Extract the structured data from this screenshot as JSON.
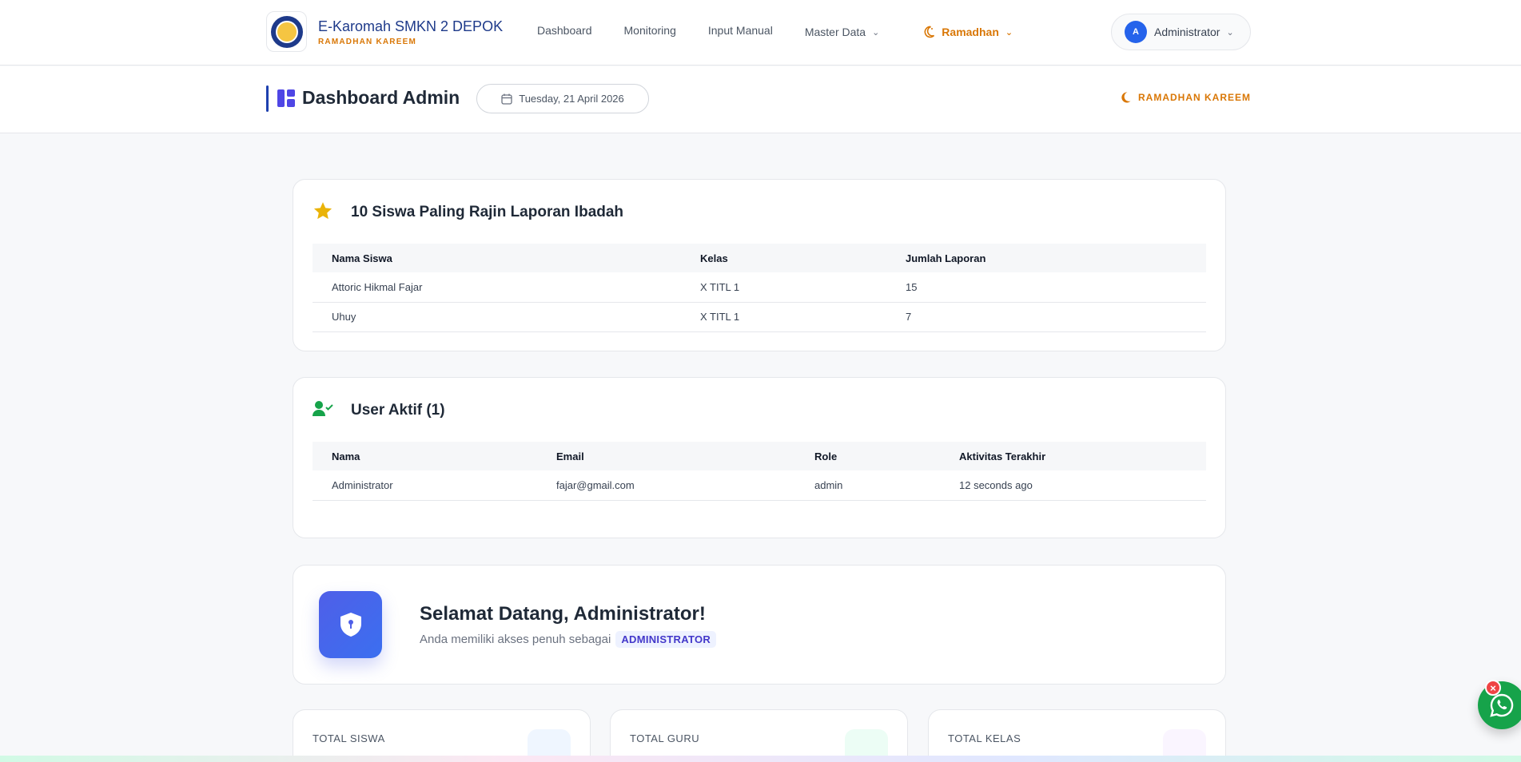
{
  "brand": {
    "title": "E-Karomah SMKN 2 DEPOK",
    "subtitle": "RAMADHAN KAREEM"
  },
  "nav": {
    "dashboard": "Dashboard",
    "monitoring": "Monitoring",
    "input_manual": "Input Manual",
    "master_data": "Master Data",
    "ramadhan": "Ramadhan"
  },
  "user": {
    "initial": "A",
    "name": "Administrator"
  },
  "page": {
    "title": "Dashboard Admin",
    "date": "Tuesday, 21 April 2026",
    "badge": "RAMADHAN KAREEM"
  },
  "top_students": {
    "title": "10 Siswa Paling Rajin Laporan Ibadah",
    "columns": [
      "Nama Siswa",
      "Kelas",
      "Jumlah Laporan"
    ],
    "rows": [
      [
        "Attoric Hikmal Fajar",
        "X TITL 1",
        "15"
      ],
      [
        "Uhuy",
        "X TITL 1",
        "7"
      ]
    ]
  },
  "active_users": {
    "title": "User Aktif (1)",
    "columns": [
      "Nama",
      "Email",
      "Role",
      "Aktivitas Terakhir"
    ],
    "rows": [
      [
        "Administrator",
        "fajar@gmail.com",
        "admin",
        "12 seconds ago"
      ]
    ]
  },
  "welcome": {
    "title": "Selamat Datang, Administrator!",
    "subtitle": "Anda memiliki akses penuh sebagai",
    "role": "ADMINISTRATOR"
  },
  "stats": {
    "siswa": "TOTAL SISWA",
    "guru": "TOTAL GURU",
    "kelas": "TOTAL KELAS"
  },
  "colors": {
    "primary": "#1e3a8a",
    "accent": "#d97706",
    "whatsapp": "#16a34a"
  },
  "icons": [
    "star-icon",
    "user-check-icon",
    "shield-icon",
    "calendar-icon",
    "moon-icon",
    "whatsapp-icon"
  ]
}
